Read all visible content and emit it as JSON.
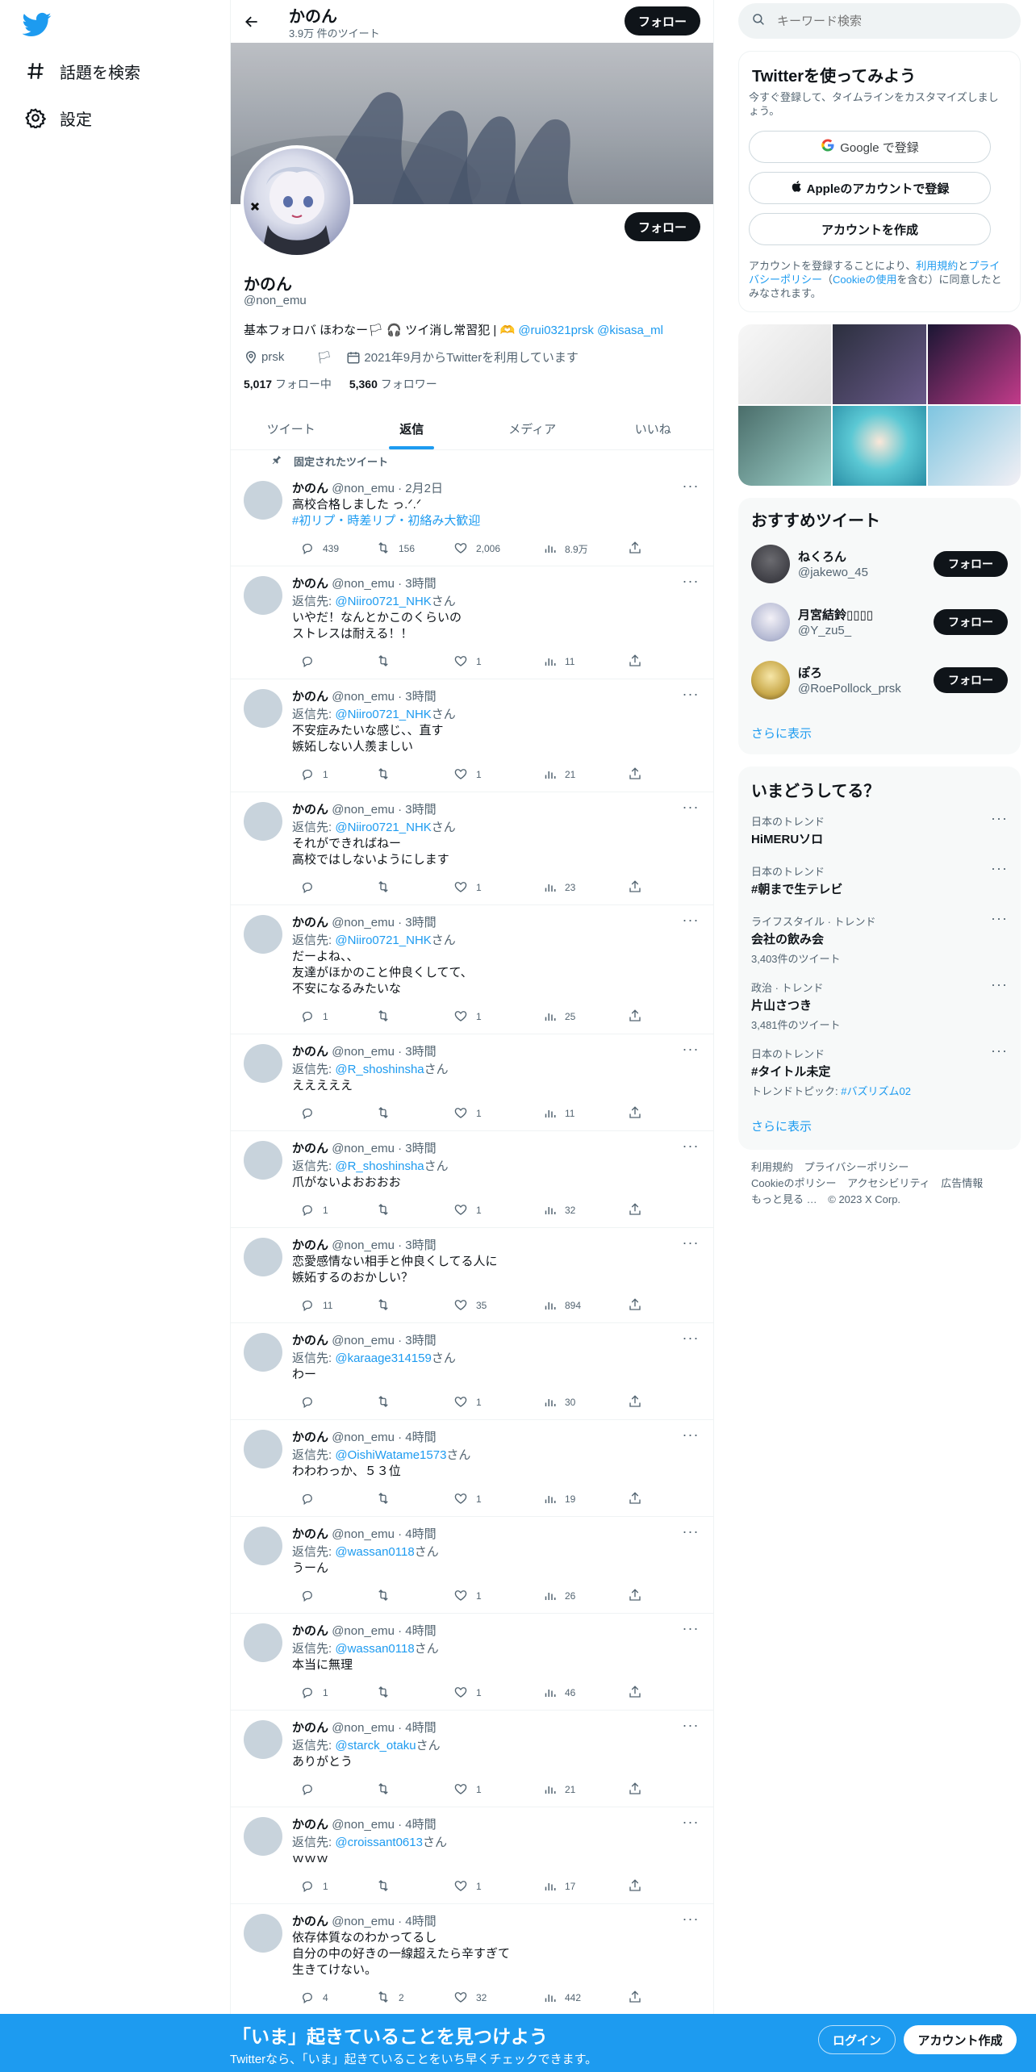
{
  "nav": {
    "items": [
      {
        "icon": "hashtag-icon",
        "label": "話題を検索"
      },
      {
        "icon": "gear-icon",
        "label": "設定"
      }
    ]
  },
  "profile_header": {
    "name": "かのん",
    "tweet_count": "3.9万 件のツイート",
    "follow_label": "フォロー"
  },
  "profile": {
    "name": "かのん",
    "handle": "@non_emu",
    "bio_text": "基本フォロバ ほわなー🏳 🎧 ツイ消し常習犯 | 🫶",
    "bio_mention1": "@rui0321prsk",
    "bio_mention2": "@kisasa_ml",
    "location": "prsk",
    "flag": "🏳",
    "joined": "2021年9月からTwitterを利用しています",
    "following_count": "5,017",
    "following_label": "フォロー中",
    "followers_count": "5,360",
    "followers_label": "フォロワー",
    "follow_label": "フォロー"
  },
  "tabs": [
    "ツイート",
    "返信",
    "メディア",
    "いいね"
  ],
  "active_tab": "返信",
  "pinned_label": "固定されたツイート",
  "tweets": [
    {
      "name": "かのん",
      "meta": "@non_emu · 2月2日",
      "reply_prefix": "",
      "reply_to": "",
      "reply_suffix": "",
      "lines": [
        "高校合格しました っ.ᐟ.ᐟ"
      ],
      "hashtags": "#初リプ・時差リプ・初絡み大歓迎",
      "replies": "439",
      "retweets": "156",
      "likes": "2,006",
      "views": "8.9万"
    },
    {
      "name": "かのん",
      "meta": "@non_emu · 3時間",
      "reply_prefix": "返信先: ",
      "reply_to": "@Niiro0721_NHK",
      "reply_suffix": "さん",
      "lines": [
        "いやだ！なんとかこのくらいの",
        "ストレスは耐える！！"
      ],
      "hashtags": "",
      "replies": "",
      "retweets": "",
      "likes": "1",
      "views": "11"
    },
    {
      "name": "かのん",
      "meta": "@non_emu · 3時間",
      "reply_prefix": "返信先: ",
      "reply_to": "@Niiro0721_NHK",
      "reply_suffix": "さん",
      "lines": [
        "不安症みたいな感じ、、直す",
        "嫉妬しない人羨ましい"
      ],
      "hashtags": "",
      "replies": "1",
      "retweets": "",
      "likes": "1",
      "views": "21"
    },
    {
      "name": "かのん",
      "meta": "@non_emu · 3時間",
      "reply_prefix": "返信先: ",
      "reply_to": "@Niiro0721_NHK",
      "reply_suffix": "さん",
      "lines": [
        "それができればねー",
        "高校ではしないようにします"
      ],
      "hashtags": "",
      "replies": "",
      "retweets": "",
      "likes": "1",
      "views": "23"
    },
    {
      "name": "かのん",
      "meta": "@non_emu · 3時間",
      "reply_prefix": "返信先: ",
      "reply_to": "@Niiro0721_NHK",
      "reply_suffix": "さん",
      "lines": [
        "だーよね、、",
        "友達がほかのこと仲良くしてて、",
        "不安になるみたいな"
      ],
      "hashtags": "",
      "replies": "1",
      "retweets": "",
      "likes": "1",
      "views": "25"
    },
    {
      "name": "かのん",
      "meta": "@non_emu · 3時間",
      "reply_prefix": "返信先: ",
      "reply_to": "@R_shoshinsha",
      "reply_suffix": "さん",
      "lines": [
        "えええええ"
      ],
      "hashtags": "",
      "replies": "",
      "retweets": "",
      "likes": "1",
      "views": "11"
    },
    {
      "name": "かのん",
      "meta": "@non_emu · 3時間",
      "reply_prefix": "返信先: ",
      "reply_to": "@R_shoshinsha",
      "reply_suffix": "さん",
      "lines": [
        "爪がないよおおおお"
      ],
      "hashtags": "",
      "replies": "1",
      "retweets": "",
      "likes": "1",
      "views": "32"
    },
    {
      "name": "かのん",
      "meta": "@non_emu · 3時間",
      "reply_prefix": "",
      "reply_to": "",
      "reply_suffix": "",
      "lines": [
        "恋愛感情ない相手と仲良くしてる人に",
        "嫉妬するのおかしい？"
      ],
      "hashtags": "",
      "replies": "11",
      "retweets": "",
      "likes": "35",
      "views": "894"
    },
    {
      "name": "かのん",
      "meta": "@non_emu · 3時間",
      "reply_prefix": "返信先: ",
      "reply_to": "@karaage314159",
      "reply_suffix": "さん",
      "lines": [
        "わー"
      ],
      "hashtags": "",
      "replies": "",
      "retweets": "",
      "likes": "1",
      "views": "30"
    },
    {
      "name": "かのん",
      "meta": "@non_emu · 4時間",
      "reply_prefix": "返信先: ",
      "reply_to": "@OishiWatame1573",
      "reply_suffix": "さん",
      "lines": [
        "わわわっか、５３位"
      ],
      "hashtags": "",
      "replies": "",
      "retweets": "",
      "likes": "1",
      "views": "19"
    },
    {
      "name": "かのん",
      "meta": "@non_emu · 4時間",
      "reply_prefix": "返信先: ",
      "reply_to": "@wassan0118",
      "reply_suffix": "さん",
      "lines": [
        "うーん"
      ],
      "hashtags": "",
      "replies": "",
      "retweets": "",
      "likes": "1",
      "views": "26"
    },
    {
      "name": "かのん",
      "meta": "@non_emu · 4時間",
      "reply_prefix": "返信先: ",
      "reply_to": "@wassan0118",
      "reply_suffix": "さん",
      "lines": [
        "本当に無理"
      ],
      "hashtags": "",
      "replies": "1",
      "retweets": "",
      "likes": "1",
      "views": "46"
    },
    {
      "name": "かのん",
      "meta": "@non_emu · 4時間",
      "reply_prefix": "返信先: ",
      "reply_to": "@starck_otaku",
      "reply_suffix": "さん",
      "lines": [
        "ありがとう"
      ],
      "hashtags": "",
      "replies": "",
      "retweets": "",
      "likes": "1",
      "views": "21"
    },
    {
      "name": "かのん",
      "meta": "@non_emu · 4時間",
      "reply_prefix": "返信先: ",
      "reply_to": "@croissant0613",
      "reply_suffix": "さん",
      "lines": [
        "ｗｗｗ"
      ],
      "hashtags": "",
      "replies": "1",
      "retweets": "",
      "likes": "1",
      "views": "17"
    },
    {
      "name": "かのん",
      "meta": "@non_emu · 4時間",
      "reply_prefix": "",
      "reply_to": "",
      "reply_suffix": "",
      "lines": [
        "依存体質なのわかってるし",
        "自分の中の好きの一線超えたら辛すぎて",
        "生きてけない。"
      ],
      "hashtags": "",
      "replies": "4",
      "retweets": "2",
      "likes": "32",
      "views": "442"
    }
  ],
  "sidebar": {
    "search_placeholder": "キーワード検索",
    "signup": {
      "title": "Twitterを使ってみよう",
      "subtitle": "今すぐ登録して、タイムラインをカスタマイズしましょう。",
      "google_label": "Google で登録",
      "apple_label": "Appleのアカウントで登録",
      "create_label": "アカウントを作成",
      "terms_prefix": "アカウントを登録することにより、",
      "terms_link": "利用規約",
      "terms_and": "と",
      "privacy_link": "プライバシーポリシー",
      "cookie_open": "（",
      "cookie_link": "Cookieの使用",
      "terms_suffix": "を含む）に同意したとみなされます。"
    },
    "recommend": {
      "title": "おすすめツイート",
      "users": [
        {
          "name": "ねくろん",
          "handle": "@jakewo_45",
          "follow_label": "フォロー"
        },
        {
          "name": "月宮結鈴▯▯▯▯",
          "handle": "@Y_zu5_",
          "follow_label": "フォロー"
        },
        {
          "name": "ぽろ",
          "handle": "@RoePollock_prsk",
          "follow_label": "フォロー"
        }
      ],
      "more_label": "さらに表示"
    },
    "trends": {
      "title": "いまどうしてる？",
      "items": [
        {
          "context": "日本のトレンド",
          "title": "HiMERUソロ",
          "count": "",
          "topic_label": "",
          "topic": ""
        },
        {
          "context": "日本のトレンド",
          "title": "#朝まで生テレビ",
          "count": "",
          "topic_label": "",
          "topic": ""
        },
        {
          "context": "ライフスタイル · トレンド",
          "title": "会社の飲み会",
          "count": "3,403件のツイート",
          "topic_label": "",
          "topic": ""
        },
        {
          "context": "政治 · トレンド",
          "title": "片山さつき",
          "count": "3,481件のツイート",
          "topic_label": "",
          "topic": ""
        },
        {
          "context": "日本のトレンド",
          "title": "#タイトル未定",
          "count": "",
          "topic_label": "トレンドトピック: ",
          "topic": "#バズリズム02"
        }
      ],
      "more_label": "さらに表示"
    },
    "footer": [
      "利用規約",
      "プライバシーポリシー",
      "Cookieのポリシー",
      "アクセシビリティ",
      "広告情報",
      "もっと見る …",
      "© 2023 X Corp."
    ]
  },
  "bottom_bar": {
    "headline": "「いま」起きていることを見つけよう",
    "subtext": "Twitterなら、「いま」起きていることをいち早くチェックできます。",
    "login_label": "ログイン",
    "signup_label": "アカウント作成"
  },
  "colors": {
    "accent": "#1d9bf0",
    "text": "#0f1419",
    "muted": "#536471",
    "bottom_bar": "#1d9bf0"
  }
}
